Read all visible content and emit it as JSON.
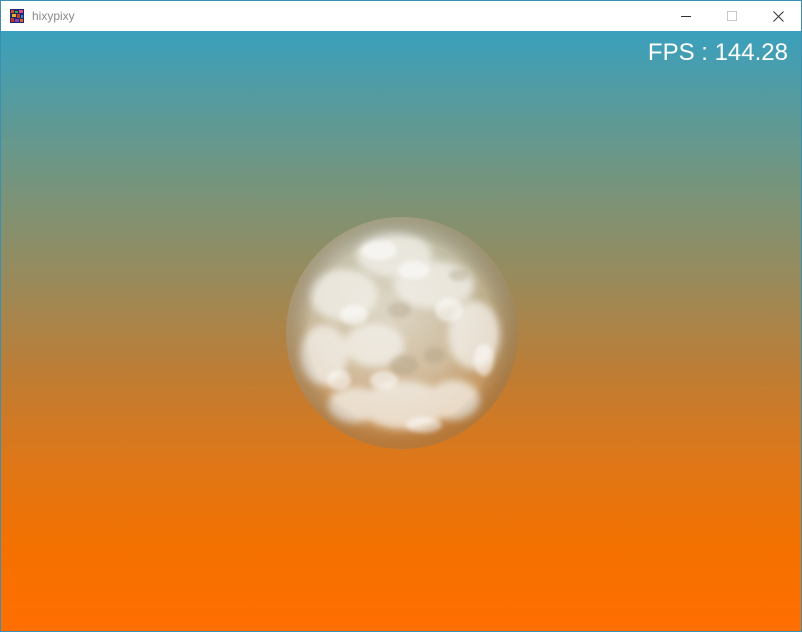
{
  "window": {
    "title": "hixypixy",
    "icon": "app-icon",
    "controls": {
      "minimize_icon": "minimize-icon",
      "maximize_icon": "maximize-icon",
      "close_icon": "close-icon"
    }
  },
  "scene": {
    "fps_text": "FPS : 144.28",
    "background_colors": {
      "top": "#3aa0bd",
      "middle": "#9a8a5a",
      "bottom": "#ff6e00"
    },
    "object": "cloudy-sphere",
    "sphere_color": "#e8e4da"
  }
}
